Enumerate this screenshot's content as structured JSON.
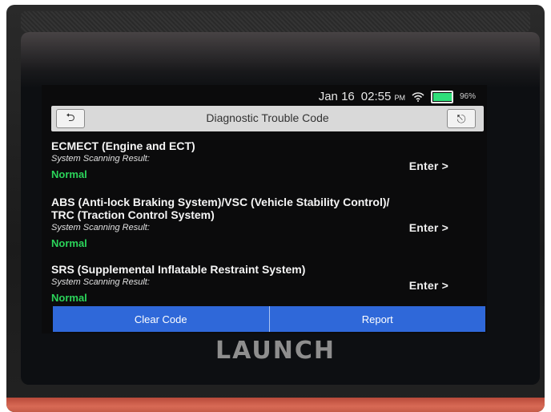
{
  "status": {
    "date": "Jan 16",
    "time": "02:55",
    "time_suffix": "PM",
    "battery_percent": "96%",
    "battery_level": 0.96
  },
  "header": {
    "title": "Diagnostic Trouble Code",
    "back_icon": "back-arrow-icon",
    "exit_icon": "exit-icon"
  },
  "systems": [
    {
      "name_line1": "ECMECT (Engine and ECT)",
      "name_line2": "",
      "result_label": "System Scanning Result:",
      "result": "Normal",
      "enter_label": "Enter >"
    },
    {
      "name_line1": "ABS (Anti-lock Braking System)/VSC (Vehicle Stability Control)/",
      "name_line2": "TRC (Traction Control System)",
      "result_label": "System Scanning Result:",
      "result": "Normal",
      "enter_label": "Enter >"
    },
    {
      "name_line1": "SRS (Supplemental Inflatable Restraint System)",
      "name_line2": "",
      "result_label": "System Scanning Result:",
      "result": "Normal",
      "enter_label": "Enter >"
    }
  ],
  "actions": {
    "clear_code": "Clear Code",
    "report": "Report"
  },
  "brand": "LAUNCH",
  "colors": {
    "action_blue": "#2f68d9",
    "normal_green": "#2bd45a",
    "title_bar": "#d9d9d9"
  }
}
